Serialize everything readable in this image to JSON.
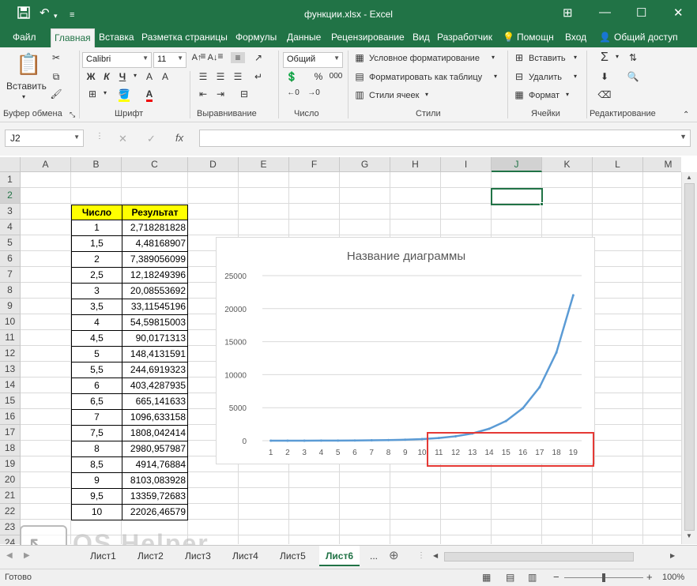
{
  "window": {
    "title": "функции.xlsx - Excel",
    "minimize": "—",
    "restore": "☐",
    "close": "✕",
    "ribbon_opts": "⊞"
  },
  "tabs": [
    "Файл",
    "Главная",
    "Вставка",
    "Разметка страницы",
    "Формулы",
    "Данные",
    "Рецензирование",
    "Вид",
    "Разработчик"
  ],
  "tell_me": "Помощн",
  "sign_in": "Вход",
  "share": "Общий доступ",
  "ribbon": {
    "paste": "Вставить",
    "font_name": "Calibri",
    "font_size": "11",
    "bold": "Ж",
    "italic": "К",
    "underline": "Ч",
    "number_format": "Общий",
    "cond_format": "Условное форматирование",
    "format_table": "Форматировать как таблицу",
    "cell_styles": "Стили ячеек",
    "insert": "Вставить",
    "delete": "Удалить",
    "format": "Формат",
    "groups": [
      "Буфер обмена",
      "Шрифт",
      "Выравнивание",
      "Число",
      "Стили",
      "Ячейки",
      "Редактирование"
    ]
  },
  "formula_bar": {
    "name_box": "J2",
    "fx": "fx",
    "cancel": "✕",
    "enter": "✓",
    "value": ""
  },
  "columns": [
    "A",
    "B",
    "C",
    "D",
    "E",
    "F",
    "G",
    "H",
    "I",
    "J",
    "K",
    "L",
    "M"
  ],
  "rows": [
    "1",
    "2",
    "3",
    "4",
    "5",
    "6",
    "7",
    "8",
    "9",
    "10",
    "11",
    "12",
    "13",
    "14",
    "15",
    "16",
    "17",
    "18",
    "19",
    "20",
    "21",
    "22",
    "23",
    "24"
  ],
  "table": {
    "header_b": "Число",
    "header_c": "Результат",
    "data": [
      [
        "1",
        "2,718281828"
      ],
      [
        "1,5",
        "4,48168907"
      ],
      [
        "2",
        "7,389056099"
      ],
      [
        "2,5",
        "12,18249396"
      ],
      [
        "3",
        "20,08553692"
      ],
      [
        "3,5",
        "33,11545196"
      ],
      [
        "4",
        "54,59815003"
      ],
      [
        "4,5",
        "90,0171313"
      ],
      [
        "5",
        "148,4131591"
      ],
      [
        "5,5",
        "244,6919323"
      ],
      [
        "6",
        "403,4287935"
      ],
      [
        "6,5",
        "665,141633"
      ],
      [
        "7",
        "1096,633158"
      ],
      [
        "7,5",
        "1808,042414"
      ],
      [
        "8",
        "2980,957987"
      ],
      [
        "8,5",
        "4914,76884"
      ],
      [
        "9",
        "8103,083928"
      ],
      [
        "9,5",
        "13359,72683"
      ],
      [
        "10",
        "22026,46579"
      ]
    ]
  },
  "chart_data": {
    "type": "line",
    "title": "Название диаграммы",
    "categories": [
      "1",
      "2",
      "3",
      "4",
      "5",
      "6",
      "7",
      "8",
      "9",
      "10",
      "11",
      "12",
      "13",
      "14",
      "15",
      "16",
      "17",
      "18",
      "19"
    ],
    "series": [
      {
        "values": [
          2.718,
          4.482,
          7.389,
          12.18,
          20.09,
          33.12,
          54.6,
          90.02,
          148.4,
          244.7,
          403.4,
          665.1,
          1096.6,
          1808.0,
          2981.0,
          4914.8,
          8103.1,
          13359.7,
          22026.5
        ]
      }
    ],
    "y_ticks": [
      "0",
      "5000",
      "10000",
      "15000",
      "20000",
      "25000"
    ],
    "ylim": [
      0,
      25000
    ],
    "grid": true,
    "line_color": "#5b9bd5",
    "highlight_color": "#e53935"
  },
  "sheets": [
    "Лист1",
    "Лист2",
    "Лист3",
    "Лист4",
    "Лист5",
    "Лист6"
  ],
  "active_sheet": "Лист6",
  "more_sheets": "...",
  "status": {
    "ready": "Готово",
    "zoom": "100%"
  },
  "watermark": "OS Helper"
}
